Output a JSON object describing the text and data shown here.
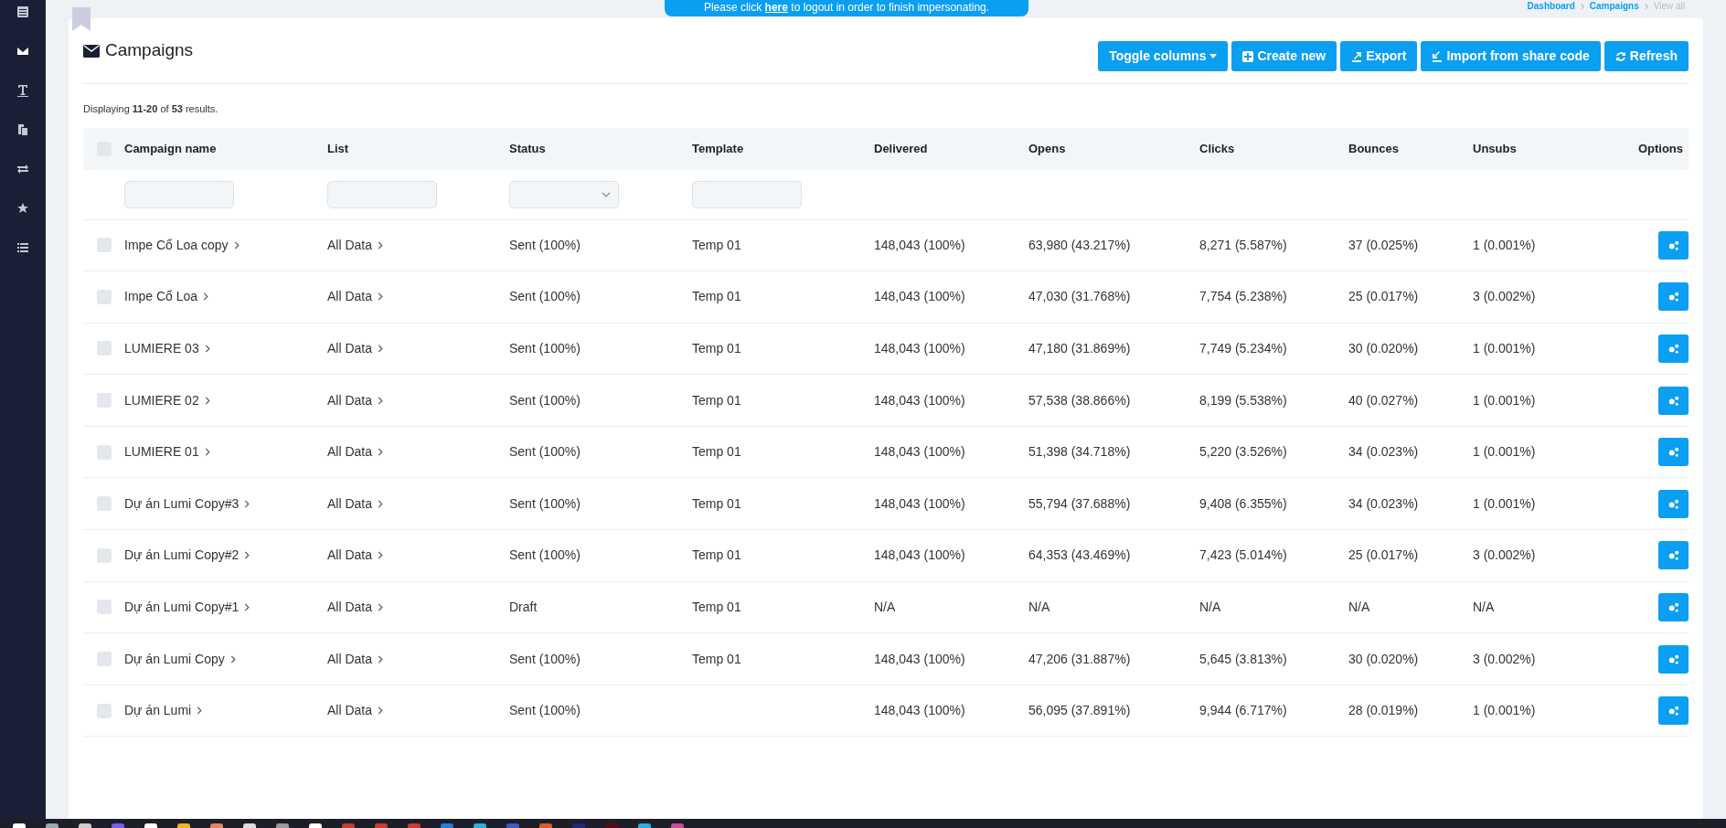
{
  "banner": {
    "before": "Please click ",
    "link": "here",
    "after": " to logout in order to finish impersonating."
  },
  "breadcrumbs": [
    {
      "label": "Dashboard",
      "current": false
    },
    {
      "label": "Campaigns",
      "current": false
    },
    {
      "label": "View all",
      "current": true
    }
  ],
  "sidebar": {
    "items": [
      {
        "kind": "table",
        "selected": false
      },
      {
        "kind": "envelope",
        "selected": true
      },
      {
        "kind": "text",
        "selected": false
      },
      {
        "kind": "copy",
        "selected": false
      },
      {
        "kind": "exchange",
        "selected": false
      },
      {
        "kind": "star",
        "selected": false
      },
      {
        "kind": "list",
        "selected": false
      }
    ]
  },
  "page": {
    "title": "Campaigns"
  },
  "toolbar": [
    {
      "label": "Toggle columns",
      "kind": "dropdown"
    },
    {
      "label": "Create new",
      "kind": "create"
    },
    {
      "label": "Export",
      "kind": "export"
    },
    {
      "label": "Import from share code",
      "kind": "import"
    },
    {
      "label": "Refresh",
      "kind": "refresh"
    }
  ],
  "summary": "Displaying **11-20** of **53** results.",
  "table": {
    "select_all": {
      "checked": false
    },
    "columns": [
      "Campaign name",
      "List",
      "Status",
      "Template",
      "Delivered",
      "Opens",
      "Clicks",
      "Bounces",
      "Unsubs",
      "Options"
    ],
    "filters": [
      {
        "kind": "text"
      },
      {
        "kind": "text"
      },
      {
        "kind": "select"
      },
      {
        "kind": "text"
      }
    ],
    "rows": [
      {
        "checked": false,
        "name": "Impe Cổ Loa copy",
        "list": "All Data",
        "status": "Sent (100%)",
        "template": "Temp 01",
        "delivered": "148,043 (100%)",
        "opens": "63,980 (43.217%)",
        "clicks": "8,271 (5.587%)",
        "bounces": "37 (0.025%)",
        "unsubs": "1 (0.001%)"
      },
      {
        "checked": false,
        "name": "Impe Cổ Loa",
        "list": "All Data",
        "status": "Sent (100%)",
        "template": "Temp 01",
        "delivered": "148,043 (100%)",
        "opens": "47,030 (31.768%)",
        "clicks": "7,754 (5.238%)",
        "bounces": "25 (0.017%)",
        "unsubs": "3 (0.002%)"
      },
      {
        "checked": false,
        "name": "LUMIERE 03",
        "list": "All Data",
        "status": "Sent (100%)",
        "template": "Temp 01",
        "delivered": "148,043 (100%)",
        "opens": "47,180 (31.869%)",
        "clicks": "7,749 (5.234%)",
        "bounces": "30 (0.020%)",
        "unsubs": "1 (0.001%)"
      },
      {
        "checked": false,
        "name": "LUMIERE 02",
        "list": "All Data",
        "status": "Sent (100%)",
        "template": "Temp 01",
        "delivered": "148,043 (100%)",
        "opens": "57,538 (38.866%)",
        "clicks": "8,199 (5.538%)",
        "bounces": "40 (0.027%)",
        "unsubs": "1 (0.001%)"
      },
      {
        "checked": false,
        "name": "LUMIERE 01",
        "list": "All Data",
        "status": "Sent (100%)",
        "template": "Temp 01",
        "delivered": "148,043 (100%)",
        "opens": "51,398 (34.718%)",
        "clicks": "5,220 (3.526%)",
        "bounces": "34 (0.023%)",
        "unsubs": "1 (0.001%)"
      },
      {
        "checked": false,
        "name": "Dự án Lumi Copy#3",
        "list": "All Data",
        "status": "Sent (100%)",
        "template": "Temp 01",
        "delivered": "148,043 (100%)",
        "opens": "55,794 (37.688%)",
        "clicks": "9,408 (6.355%)",
        "bounces": "34 (0.023%)",
        "unsubs": "1 (0.001%)"
      },
      {
        "checked": false,
        "name": "Dự án Lumi Copy#2",
        "list": "All Data",
        "status": "Sent (100%)",
        "template": "Temp 01",
        "delivered": "148,043 (100%)",
        "opens": "64,353 (43.469%)",
        "clicks": "7,423 (5.014%)",
        "bounces": "25 (0.017%)",
        "unsubs": "3 (0.002%)"
      },
      {
        "checked": false,
        "name": "Dự án Lumi Copy#1",
        "list": "All Data",
        "status": "Draft",
        "template": "Temp 01",
        "delivered": "N/A",
        "opens": "N/A",
        "clicks": "N/A",
        "bounces": "N/A",
        "unsubs": "N/A"
      },
      {
        "checked": false,
        "name": "Dự án Lumi Copy",
        "list": "All Data",
        "status": "Sent (100%)",
        "template": "Temp 01",
        "delivered": "148,043 (100%)",
        "opens": "47,206 (31.887%)",
        "clicks": "5,645 (3.813%)",
        "bounces": "30 (0.020%)",
        "unsubs": "3 (0.002%)"
      },
      {
        "checked": false,
        "name": "Dự án Lumi",
        "list": "All Data",
        "status": "Sent (100%)",
        "delivered": "148,043 (100%)",
        "opens": "56,095 (37.891%)",
        "clicks": "9,944 (6.717%)",
        "bounces": "28 (0.019%)",
        "unsubs": "1 (0.001%)"
      }
    ]
  }
}
